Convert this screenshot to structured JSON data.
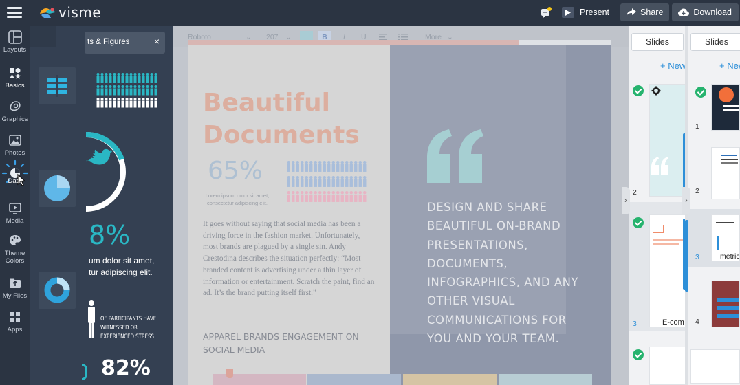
{
  "app": {
    "logo_text": "visme"
  },
  "toolbar": {
    "present_label": "Present",
    "share_label": "Share",
    "download_label": "Download"
  },
  "rail": {
    "items": [
      {
        "label": "Layouts",
        "icon": "layouts-icon"
      },
      {
        "label": "Basics",
        "icon": "basics-icon"
      },
      {
        "label": "Graphics",
        "icon": "graphics-icon"
      },
      {
        "label": "Photos",
        "icon": "photos-icon"
      },
      {
        "label": "Data",
        "icon": "data-icon"
      },
      {
        "label": "Media",
        "icon": "media-icon"
      },
      {
        "label": "Theme Colors",
        "icon": "palette-icon"
      },
      {
        "label": "My Files",
        "icon": "my-files-icon"
      },
      {
        "label": "Apps",
        "icon": "apps-icon"
      }
    ]
  },
  "panel": {
    "title": "ts & Figures",
    "close": "×",
    "preview_text_1": "8%",
    "preview_text_2": "um dolor sit amet,",
    "preview_text_3": "tur adipiscing elit.",
    "preview_text_4": "OF PARTICIPANTS HAVE",
    "preview_text_5": "WITNESSED OR",
    "preview_text_6": "EXPERIENCED STRESS",
    "preview_text_7": "82%"
  },
  "format_bar": {
    "font": "Roboto",
    "size": "207",
    "bold": "B",
    "italic": "I",
    "underline": "U",
    "more": "More"
  },
  "document": {
    "title_line1": "Beautiful",
    "title_line2": "Documents",
    "percent": "65%",
    "lorem_small": "Lorem ipsum dolor sit amet, consectetur adipiscing elit.",
    "body_copy": "It goes without saying that social media has been a driving force in the fashion market. Unfortunately, most brands are plagued by a single sin. Andy Crestodina describes the situation perfectly: “Most branded content is advertising under a thin layer of information or entertainment. Scratch the paint, find an ad. It’s the brand putting itself first.”",
    "section_heading": "APPAREL BRANDS ENGAGEMENT ON SOCIAL MEDIA",
    "quote_text": "DESIGN AND SHARE BEAUTIFUL ON-BRAND PRESENTATIONS, DOCUMENTS, INFOGRAPHICS, AND ANY OTHER VISUAL COMMUNICATIONS FOR YOU AND YOUR TEAM."
  },
  "slides_panel_1": {
    "tab_label": "Slides",
    "new_label": "+ New",
    "numbers": [
      "2",
      "3"
    ],
    "thumb_text": "E-com"
  },
  "slides_panel_2": {
    "tab_label": "Slides",
    "new_label": "+ New",
    "numbers": [
      "1",
      "2",
      "3",
      "4"
    ],
    "thumb_text": "metric"
  },
  "colors": {
    "accent": "#2d8fd8",
    "teal": "#2ab7c4",
    "check_green": "#26b36e",
    "title_salmon": "#dcae9f"
  }
}
